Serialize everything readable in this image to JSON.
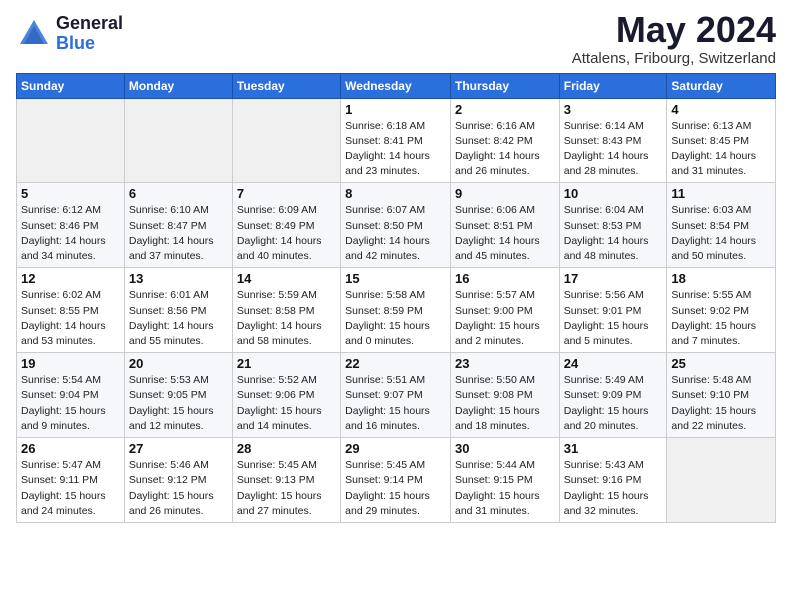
{
  "header": {
    "logo_general": "General",
    "logo_blue": "Blue",
    "month_title": "May 2024",
    "location": "Attalens, Fribourg, Switzerland"
  },
  "days_of_week": [
    "Sunday",
    "Monday",
    "Tuesday",
    "Wednesday",
    "Thursday",
    "Friday",
    "Saturday"
  ],
  "weeks": [
    [
      {
        "day": "",
        "info": ""
      },
      {
        "day": "",
        "info": ""
      },
      {
        "day": "",
        "info": ""
      },
      {
        "day": "1",
        "info": "Sunrise: 6:18 AM\nSunset: 8:41 PM\nDaylight: 14 hours\nand 23 minutes."
      },
      {
        "day": "2",
        "info": "Sunrise: 6:16 AM\nSunset: 8:42 PM\nDaylight: 14 hours\nand 26 minutes."
      },
      {
        "day": "3",
        "info": "Sunrise: 6:14 AM\nSunset: 8:43 PM\nDaylight: 14 hours\nand 28 minutes."
      },
      {
        "day": "4",
        "info": "Sunrise: 6:13 AM\nSunset: 8:45 PM\nDaylight: 14 hours\nand 31 minutes."
      }
    ],
    [
      {
        "day": "5",
        "info": "Sunrise: 6:12 AM\nSunset: 8:46 PM\nDaylight: 14 hours\nand 34 minutes."
      },
      {
        "day": "6",
        "info": "Sunrise: 6:10 AM\nSunset: 8:47 PM\nDaylight: 14 hours\nand 37 minutes."
      },
      {
        "day": "7",
        "info": "Sunrise: 6:09 AM\nSunset: 8:49 PM\nDaylight: 14 hours\nand 40 minutes."
      },
      {
        "day": "8",
        "info": "Sunrise: 6:07 AM\nSunset: 8:50 PM\nDaylight: 14 hours\nand 42 minutes."
      },
      {
        "day": "9",
        "info": "Sunrise: 6:06 AM\nSunset: 8:51 PM\nDaylight: 14 hours\nand 45 minutes."
      },
      {
        "day": "10",
        "info": "Sunrise: 6:04 AM\nSunset: 8:53 PM\nDaylight: 14 hours\nand 48 minutes."
      },
      {
        "day": "11",
        "info": "Sunrise: 6:03 AM\nSunset: 8:54 PM\nDaylight: 14 hours\nand 50 minutes."
      }
    ],
    [
      {
        "day": "12",
        "info": "Sunrise: 6:02 AM\nSunset: 8:55 PM\nDaylight: 14 hours\nand 53 minutes."
      },
      {
        "day": "13",
        "info": "Sunrise: 6:01 AM\nSunset: 8:56 PM\nDaylight: 14 hours\nand 55 minutes."
      },
      {
        "day": "14",
        "info": "Sunrise: 5:59 AM\nSunset: 8:58 PM\nDaylight: 14 hours\nand 58 minutes."
      },
      {
        "day": "15",
        "info": "Sunrise: 5:58 AM\nSunset: 8:59 PM\nDaylight: 15 hours\nand 0 minutes."
      },
      {
        "day": "16",
        "info": "Sunrise: 5:57 AM\nSunset: 9:00 PM\nDaylight: 15 hours\nand 2 minutes."
      },
      {
        "day": "17",
        "info": "Sunrise: 5:56 AM\nSunset: 9:01 PM\nDaylight: 15 hours\nand 5 minutes."
      },
      {
        "day": "18",
        "info": "Sunrise: 5:55 AM\nSunset: 9:02 PM\nDaylight: 15 hours\nand 7 minutes."
      }
    ],
    [
      {
        "day": "19",
        "info": "Sunrise: 5:54 AM\nSunset: 9:04 PM\nDaylight: 15 hours\nand 9 minutes."
      },
      {
        "day": "20",
        "info": "Sunrise: 5:53 AM\nSunset: 9:05 PM\nDaylight: 15 hours\nand 12 minutes."
      },
      {
        "day": "21",
        "info": "Sunrise: 5:52 AM\nSunset: 9:06 PM\nDaylight: 15 hours\nand 14 minutes."
      },
      {
        "day": "22",
        "info": "Sunrise: 5:51 AM\nSunset: 9:07 PM\nDaylight: 15 hours\nand 16 minutes."
      },
      {
        "day": "23",
        "info": "Sunrise: 5:50 AM\nSunset: 9:08 PM\nDaylight: 15 hours\nand 18 minutes."
      },
      {
        "day": "24",
        "info": "Sunrise: 5:49 AM\nSunset: 9:09 PM\nDaylight: 15 hours\nand 20 minutes."
      },
      {
        "day": "25",
        "info": "Sunrise: 5:48 AM\nSunset: 9:10 PM\nDaylight: 15 hours\nand 22 minutes."
      }
    ],
    [
      {
        "day": "26",
        "info": "Sunrise: 5:47 AM\nSunset: 9:11 PM\nDaylight: 15 hours\nand 24 minutes."
      },
      {
        "day": "27",
        "info": "Sunrise: 5:46 AM\nSunset: 9:12 PM\nDaylight: 15 hours\nand 26 minutes."
      },
      {
        "day": "28",
        "info": "Sunrise: 5:45 AM\nSunset: 9:13 PM\nDaylight: 15 hours\nand 27 minutes."
      },
      {
        "day": "29",
        "info": "Sunrise: 5:45 AM\nSunset: 9:14 PM\nDaylight: 15 hours\nand 29 minutes."
      },
      {
        "day": "30",
        "info": "Sunrise: 5:44 AM\nSunset: 9:15 PM\nDaylight: 15 hours\nand 31 minutes."
      },
      {
        "day": "31",
        "info": "Sunrise: 5:43 AM\nSunset: 9:16 PM\nDaylight: 15 hours\nand 32 minutes."
      },
      {
        "day": "",
        "info": ""
      }
    ]
  ]
}
